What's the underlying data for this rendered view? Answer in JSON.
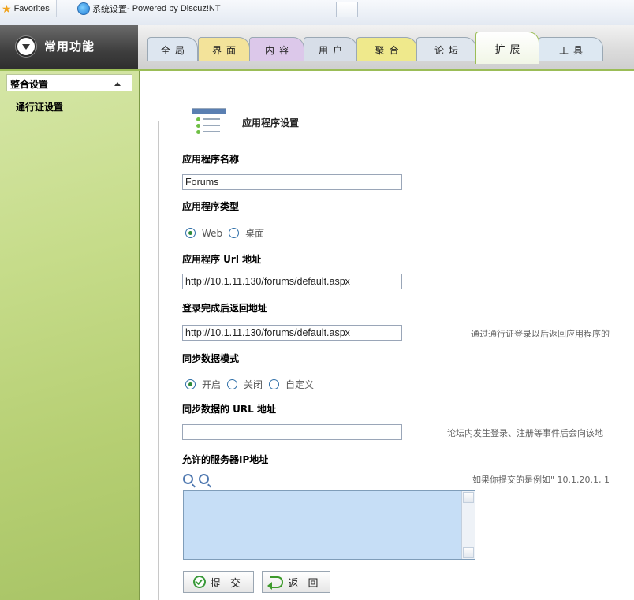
{
  "browser": {
    "favorites_label": "Favorites",
    "tab_title_cn": "系统设置",
    "tab_title_rest": " - Powered by Discuz!NT"
  },
  "header": {
    "menu_label": "常用功能",
    "tabs": [
      {
        "label": "全局",
        "color": "#dde6f0"
      },
      {
        "label": "界面",
        "color": "#f3e39a"
      },
      {
        "label": "内容",
        "color": "#dcc8ea"
      },
      {
        "label": "用户",
        "color": "#d7dee8"
      },
      {
        "label": "聚合",
        "color": "#efe98c"
      },
      {
        "label": "论坛",
        "color": "#dfe6ee"
      },
      {
        "label": "扩展",
        "color": "#ffffff"
      },
      {
        "label": "工具",
        "color": "#dde8f2"
      }
    ],
    "active_tab": "扩展"
  },
  "sidebar": {
    "group_label": "整合设置",
    "items": [
      {
        "label": "通行证设置"
      }
    ]
  },
  "form": {
    "legend": "应用程序设置",
    "app_name_label": "应用程序名称",
    "app_name_value": "Forums",
    "app_type_label": "应用程序类型",
    "app_type_options": [
      "Web",
      "桌面"
    ],
    "app_type_selected": "Web",
    "app_url_label": "应用程序 Url 地址",
    "app_url_value": "http://10.1.11.130/forums/default.aspx",
    "return_url_label": "登录完成后返回地址",
    "return_url_value": "http://10.1.11.130/forums/default.aspx",
    "return_url_hint": "通过通行证登录以后返回应用程序的",
    "sync_mode_label": "同步数据模式",
    "sync_mode_options": [
      "开启",
      "关闭",
      "自定义"
    ],
    "sync_mode_selected": "开启",
    "sync_url_label": "同步数据的 URL 地址",
    "sync_url_value": "",
    "sync_url_hint": "论坛内发生登录、注册等事件后会向该地",
    "server_ip_label": "允许的服务器IP地址",
    "server_ip_hint": "如果你提交的是例如\" 10.1.20.1, 1",
    "server_ip_value": "",
    "submit_label": "提 交",
    "back_label": "返 回"
  }
}
